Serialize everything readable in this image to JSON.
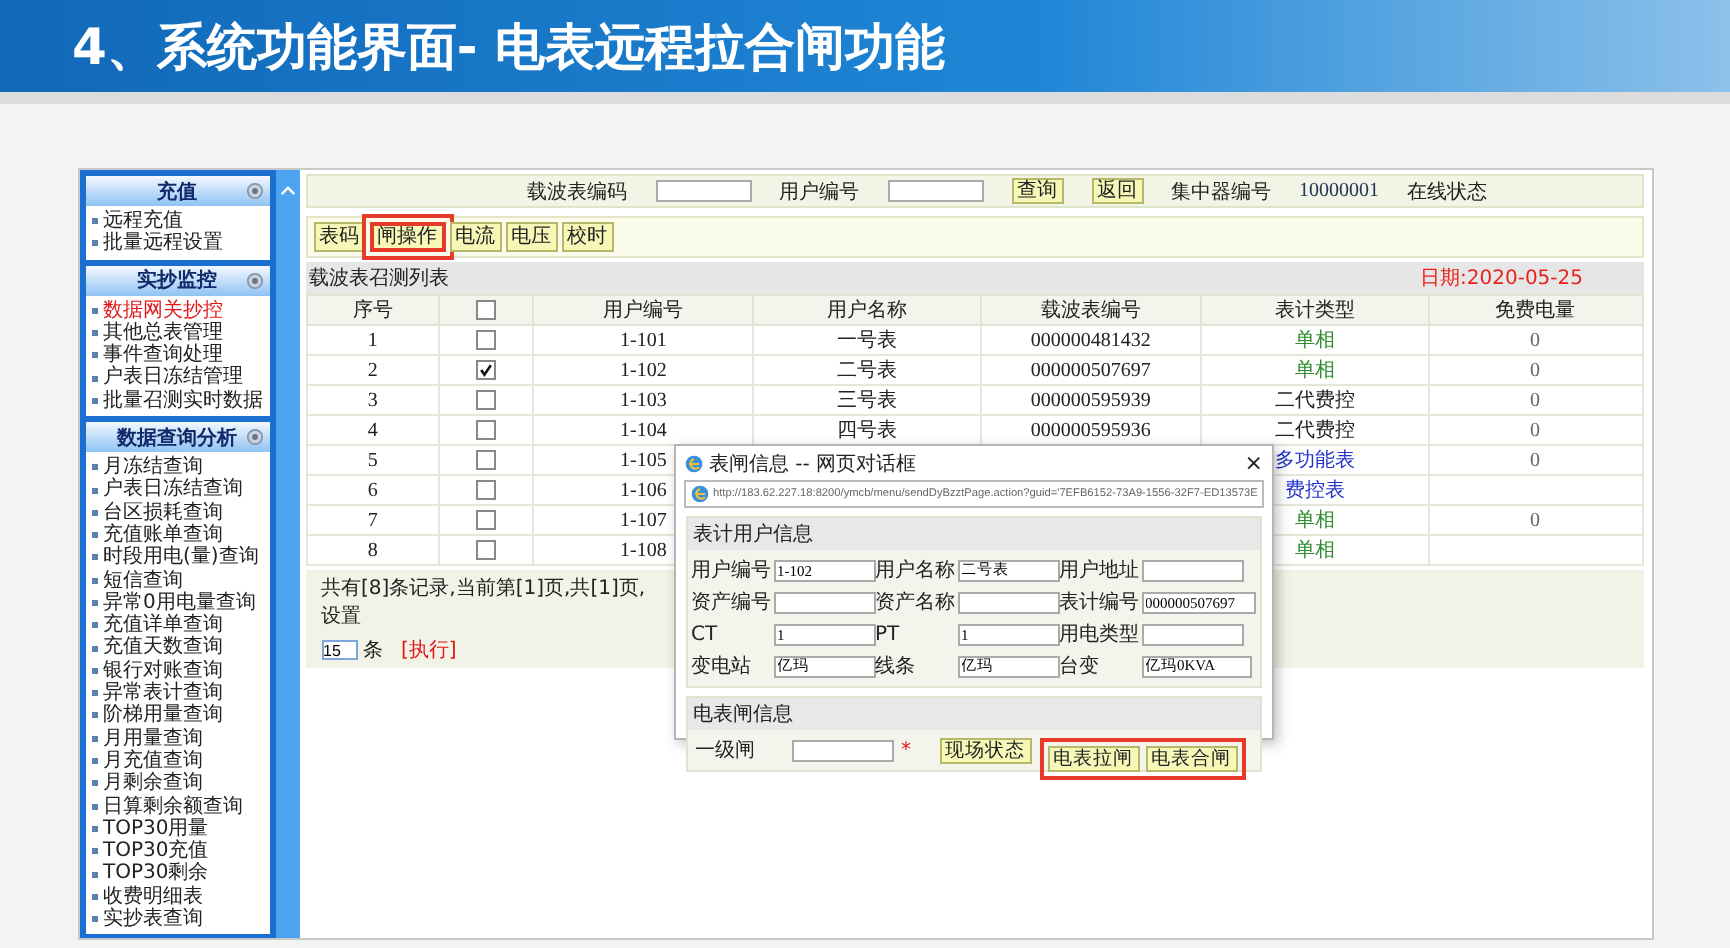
{
  "slide_title": "4、系统功能界面- 电表远程拉合闸功能",
  "sidebar": {
    "sections": [
      {
        "title": "充值",
        "items": [
          {
            "label": "远程充值",
            "selected": false
          },
          {
            "label": "批量远程设置",
            "selected": false
          }
        ]
      },
      {
        "title": "实抄监控",
        "items": [
          {
            "label": "数据网关抄控",
            "selected": true
          },
          {
            "label": "其他总表管理",
            "selected": false
          },
          {
            "label": "事件查询处理",
            "selected": false
          },
          {
            "label": "户表日冻结管理",
            "selected": false
          },
          {
            "label": "批量召测实时数据",
            "selected": false
          }
        ]
      },
      {
        "title": "数据查询分析",
        "items": [
          {
            "label": "月冻结查询",
            "selected": false
          },
          {
            "label": "户表日冻结查询",
            "selected": false
          },
          {
            "label": "台区损耗查询",
            "selected": false
          },
          {
            "label": "充值账单查询",
            "selected": false
          },
          {
            "label": "时段用电(量)查询",
            "selected": false
          },
          {
            "label": "短信查询",
            "selected": false
          },
          {
            "label": "异常0用电量查询",
            "selected": false
          },
          {
            "label": "充值详单查询",
            "selected": false
          },
          {
            "label": "充值天数查询",
            "selected": false
          },
          {
            "label": "银行对账查询",
            "selected": false
          },
          {
            "label": "异常表计查询",
            "selected": false
          },
          {
            "label": "阶梯用量查询",
            "selected": false
          },
          {
            "label": "月用量查询",
            "selected": false
          },
          {
            "label": "月充值查询",
            "selected": false
          },
          {
            "label": "月剩余查询",
            "selected": false
          },
          {
            "label": "日算剩余额查询",
            "selected": false
          },
          {
            "label": "TOP30用量",
            "selected": false
          },
          {
            "label": "TOP30充值",
            "selected": false
          },
          {
            "label": "TOP30剩余",
            "selected": false
          },
          {
            "label": "收费明细表",
            "selected": false
          },
          {
            "label": "实抄表查询",
            "selected": false
          }
        ]
      }
    ]
  },
  "query": {
    "meter_label": "载波表编码",
    "user_label": "用户编号",
    "search_button": "查询",
    "back_button": "返回",
    "concentrator_label": "集中器编号",
    "concentrator_value": "10000001",
    "status_label": "在线状态"
  },
  "toolbar": [
    {
      "label": "表码",
      "highlighted": false
    },
    {
      "label": "闸操作",
      "highlighted": true
    },
    {
      "label": "电流",
      "highlighted": false
    },
    {
      "label": "电压",
      "highlighted": false
    },
    {
      "label": "校时",
      "highlighted": false
    }
  ],
  "table": {
    "caption": "载波表召测列表",
    "date": "日期:2020-05-25",
    "columns": [
      "序号",
      "用户编号",
      "用户名称",
      "载波表编号",
      "表计类型",
      "免费电量"
    ],
    "header_checked": false,
    "rows": [
      {
        "no": "1",
        "checked": false,
        "user_no": "1-101",
        "name": "一号表",
        "meter": "000000481432",
        "type": "单相",
        "color": "#2e8b2e",
        "free": "0"
      },
      {
        "no": "2",
        "checked": true,
        "user_no": "1-102",
        "name": "二号表",
        "meter": "000000507697",
        "type": "单相",
        "color": "#2e8b2e",
        "free": "0"
      },
      {
        "no": "3",
        "checked": false,
        "user_no": "1-103",
        "name": "三号表",
        "meter": "000000595939",
        "type": "二代费控",
        "color": "#222222",
        "free": "0"
      },
      {
        "no": "4",
        "checked": false,
        "user_no": "1-104",
        "name": "四号表",
        "meter": "000000595936",
        "type": "二代费控",
        "color": "#222222",
        "free": "0"
      },
      {
        "no": "5",
        "checked": false,
        "user_no": "1-105",
        "type": "多功能表",
        "color": "#2233cc",
        "free": "0"
      },
      {
        "no": "6",
        "checked": false,
        "user_no": "1-106",
        "type": "费控表",
        "color": "#2233cc"
      },
      {
        "no": "7",
        "checked": false,
        "user_no": "1-107",
        "type": "单相",
        "color": "#2e8b2e",
        "free": "0"
      },
      {
        "no": "8",
        "checked": false,
        "user_no": "1-108",
        "type": "单相",
        "color": "#2e8b2e"
      }
    ],
    "footer": {
      "text": "共有[8]条记录,当前第[1]页,共[1]页,设置",
      "page_size": "15",
      "unit": "条",
      "run_link": "[执行]"
    }
  },
  "dialog": {
    "title": "表闸信息 -- 网页对话框",
    "close": "×",
    "url": "http://183.62.227.18:8200/ymcb/menu/sendDyBzztPage.action?guid='7EFB6152-73A9-1556-32F7-ED13573E",
    "info_title": "表计用户信息",
    "fields": [
      {
        "label": "用户编号",
        "value": "1-102"
      },
      {
        "label": "用户名称",
        "value": "二号表"
      },
      {
        "label": "用户地址"
      },
      {
        "label": "资产编号"
      },
      {
        "label": "资产名称"
      },
      {
        "label": "表计编号",
        "value": "000000507697"
      },
      {
        "label": "CT",
        "value": "1"
      },
      {
        "label": "PT",
        "value": "1"
      },
      {
        "label": "用电类型"
      },
      {
        "label": "变电站",
        "value": "亿玛"
      },
      {
        "label": "线条",
        "value": "亿玛"
      },
      {
        "label": "台变",
        "value": "亿玛0KVA"
      }
    ],
    "gate_title": "电表闸信息",
    "gate_label": "一级闸",
    "required_mark": "*",
    "buttons": [
      {
        "label": "现场状态",
        "highlighted": false
      },
      {
        "label": "电表拉闸",
        "highlighted": true
      },
      {
        "label": "电表合闸",
        "highlighted": true
      }
    ]
  }
}
